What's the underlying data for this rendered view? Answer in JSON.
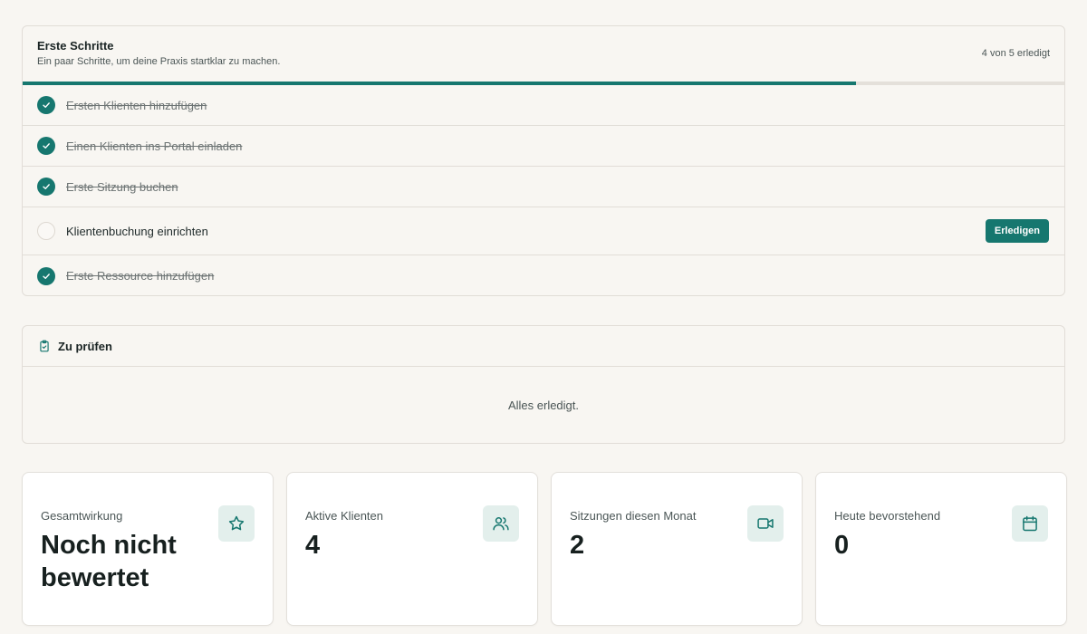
{
  "checklist": {
    "title": "Erste Schritte",
    "subtitle": "Ein paar Schritte, um deine Praxis startklar zu machen.",
    "progress_text": "4 von 5 erledigt",
    "progress_fraction": 0.8,
    "items": [
      {
        "label": "Ersten Klienten hinzufügen",
        "done": true
      },
      {
        "label": "Einen Klienten ins Portal einladen",
        "done": true
      },
      {
        "label": "Erste Sitzung buchen",
        "done": true
      },
      {
        "label": "Klientenbuchung einrichten",
        "done": false,
        "action": "Erledigen"
      },
      {
        "label": "Erste Ressource hinzufügen",
        "done": true
      }
    ]
  },
  "review": {
    "title": "Zu prüfen",
    "icon": "clipboard-check-icon",
    "empty_text": "Alles erledigt."
  },
  "stats": [
    {
      "label": "Gesamtwirkung",
      "value": "Noch nicht bewertet",
      "icon": "star-icon"
    },
    {
      "label": "Aktive Klienten",
      "value": "4",
      "icon": "users-icon"
    },
    {
      "label": "Sitzungen diesen Monat",
      "value": "2",
      "icon": "video-icon"
    },
    {
      "label": "Heute bevorstehend",
      "value": "0",
      "icon": "calendar-icon"
    }
  ],
  "colors": {
    "accent": "#16776f",
    "background": "#f8f6f2",
    "icon_bg": "#e3efec"
  }
}
